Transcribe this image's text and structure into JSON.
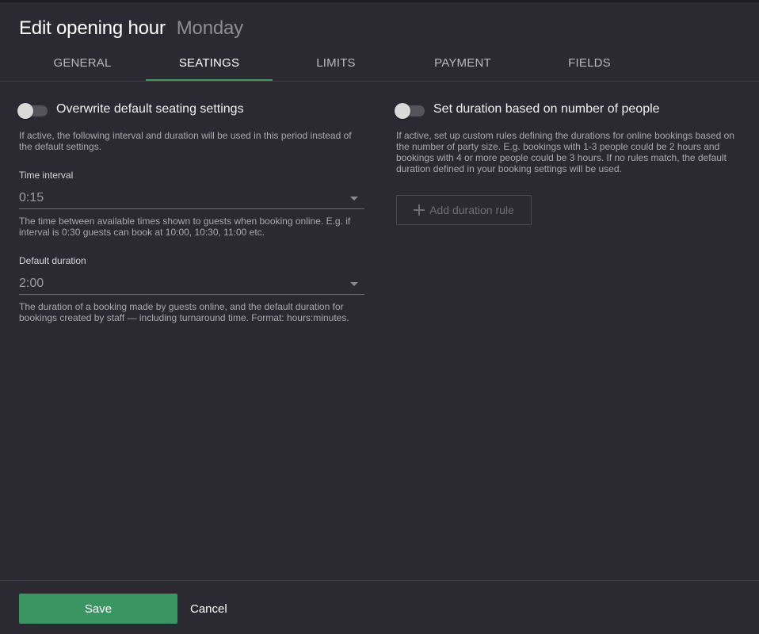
{
  "header": {
    "title": "Edit opening hour",
    "subtitle": "Monday"
  },
  "tabs": [
    {
      "label": "GENERAL"
    },
    {
      "label": "SEATINGS",
      "active": true
    },
    {
      "label": "LIMITS"
    },
    {
      "label": "PAYMENT"
    },
    {
      "label": "FIELDS"
    }
  ],
  "left": {
    "toggle": {
      "label": "Overwrite default seating settings",
      "on": false
    },
    "toggle_help": "If active, the following interval and duration will be used in this period instead of the default settings.",
    "time_interval": {
      "label": "Time interval",
      "value": "0:15",
      "help": "The time between available times shown to guests when booking online. E.g. if interval is 0:30 guests can book at 10:00, 10:30, 11:00 etc."
    },
    "default_duration": {
      "label": "Default duration",
      "value": "2:00",
      "help": "The duration of a booking made by guests online, and the default duration for bookings created by staff — including turnaround time. Format: hours:minutes."
    }
  },
  "right": {
    "toggle": {
      "label": "Set duration based on number of people",
      "on": false
    },
    "toggle_help": "If active, set up custom rules defining the durations for online bookings based on the number of party size. E.g. bookings with 1-3 people could be 2 hours and bookings with 4 or more people could be 3 hours. If no rules match, the default duration defined in your booking settings will be used.",
    "add_rule_label": "Add duration rule"
  },
  "footer": {
    "save_label": "Save",
    "cancel_label": "Cancel"
  },
  "colors": {
    "accent": "#3a9562",
    "background": "#2b2a33"
  }
}
